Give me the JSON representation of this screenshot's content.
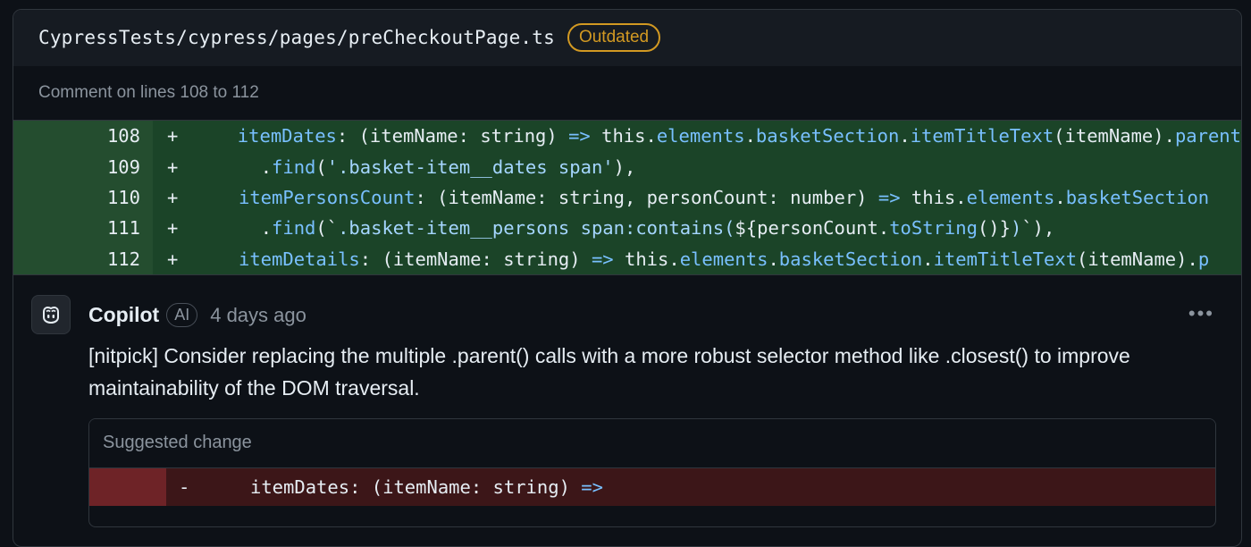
{
  "file": {
    "path": "CypressTests/cypress/pages/preCheckoutPage.ts",
    "status_badge": "Outdated",
    "comment_range": "Comment on lines 108 to 112"
  },
  "diff": {
    "sign": "+",
    "lines": [
      {
        "number": "108",
        "indent": "",
        "segments": [
          {
            "t": "itemDates",
            "c": "t-prop"
          },
          {
            "t": ": (itemName: string) "
          },
          {
            "t": "=>",
            "c": "t-op"
          },
          {
            "t": " this."
          },
          {
            "t": "elements",
            "c": "t-prop"
          },
          {
            "t": "."
          },
          {
            "t": "basketSection",
            "c": "t-prop"
          },
          {
            "t": "."
          },
          {
            "t": "itemTitleText",
            "c": "t-prop"
          },
          {
            "t": "(itemName)."
          },
          {
            "t": "parent",
            "c": "t-prop"
          }
        ]
      },
      {
        "number": "109",
        "indent": "  ",
        "segments": [
          {
            "t": "."
          },
          {
            "t": "find",
            "c": "t-prop"
          },
          {
            "t": "("
          },
          {
            "t": "'.basket-item__dates span'",
            "c": "t-str"
          },
          {
            "t": "),"
          }
        ]
      },
      {
        "number": "110",
        "indent": "",
        "segments": [
          {
            "t": "itemPersonsCount",
            "c": "t-prop"
          },
          {
            "t": ": (itemName: string, personCount: number) "
          },
          {
            "t": "=>",
            "c": "t-op"
          },
          {
            "t": " this."
          },
          {
            "t": "elements",
            "c": "t-prop"
          },
          {
            "t": "."
          },
          {
            "t": "basketSection",
            "c": "t-prop"
          }
        ]
      },
      {
        "number": "111",
        "indent": "  ",
        "segments": [
          {
            "t": "."
          },
          {
            "t": "find",
            "c": "t-prop"
          },
          {
            "t": "(`"
          },
          {
            "t": ".basket-item__persons span:contains(",
            "c": "t-str"
          },
          {
            "t": "${personCount."
          },
          {
            "t": "toString",
            "c": "t-prop"
          },
          {
            "t": "()}"
          },
          {
            "t": ")",
            "c": "t-str"
          },
          {
            "t": "`),"
          }
        ]
      },
      {
        "number": "112",
        "indent": "",
        "segments": [
          {
            "t": "itemDetails",
            "c": "t-prop"
          },
          {
            "t": ": (itemName: string) "
          },
          {
            "t": "=>",
            "c": "t-op"
          },
          {
            "t": " this."
          },
          {
            "t": "elements",
            "c": "t-prop"
          },
          {
            "t": "."
          },
          {
            "t": "basketSection",
            "c": "t-prop"
          },
          {
            "t": "."
          },
          {
            "t": "itemTitleText",
            "c": "t-prop"
          },
          {
            "t": "(itemName)."
          },
          {
            "t": "p",
            "c": "t-prop"
          }
        ]
      }
    ]
  },
  "comment": {
    "author": "Copilot",
    "author_badge": "AI",
    "timestamp": "4 days ago",
    "more_label": "•••",
    "body": "[nitpick] Consider replacing the multiple .parent() calls with a more robust selector method like .closest() to improve maintainability of the DOM traversal.",
    "suggestion": {
      "title": "Suggested change",
      "sign": "-",
      "segments": [
        {
          "t": "itemDates: (itemName: string) "
        },
        {
          "t": "=>",
          "c": "t-op"
        }
      ]
    }
  },
  "colors": {
    "background": "#0d1117",
    "added_line": "#1b4428",
    "deleted_line": "#3c1618",
    "badge_warning": "#d29922",
    "accent": "#79c0ff"
  },
  "icons": {
    "avatar": "copilot-icon",
    "more": "kebab-horizontal-icon"
  }
}
